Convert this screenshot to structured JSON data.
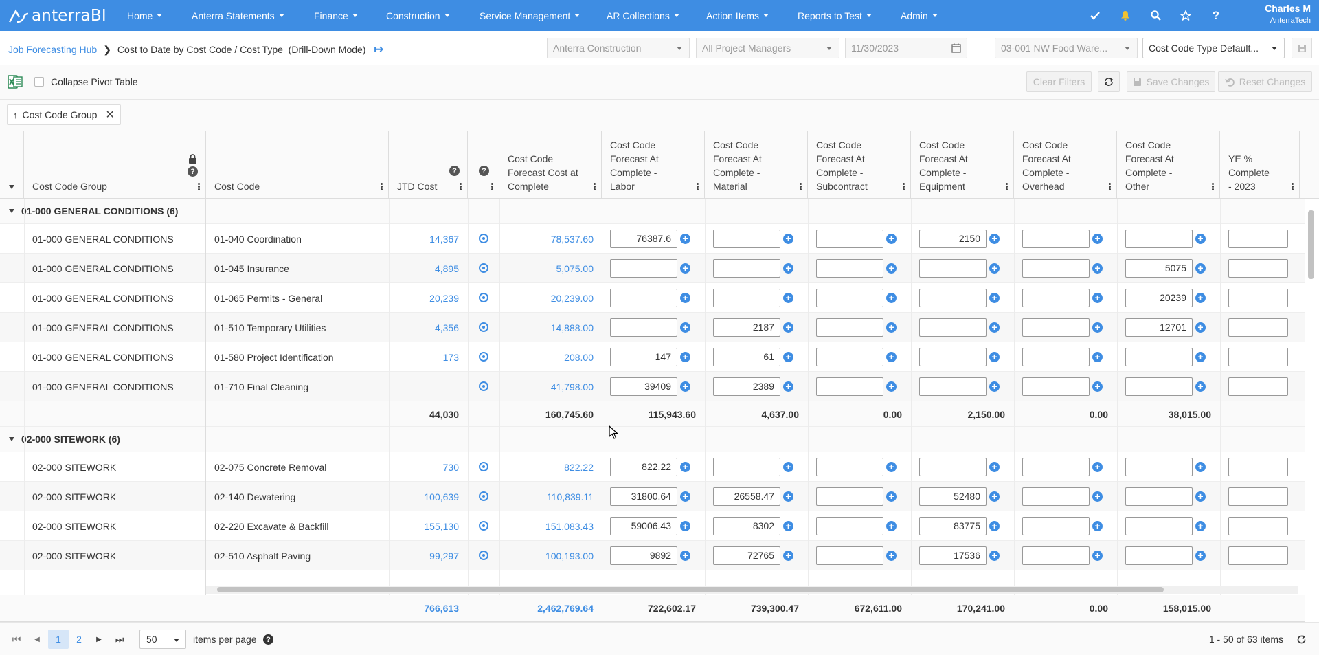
{
  "brand": {
    "name": "anterraBI"
  },
  "nav": {
    "menus": [
      "Home",
      "Anterra Statements",
      "Finance",
      "Construction",
      "Service Management",
      "AR Collections",
      "Action Items",
      "Reports to Test",
      "Admin"
    ],
    "icons": [
      "check-icon",
      "bell-icon",
      "search-icon",
      "star-icon",
      "help-icon"
    ],
    "user_name": "Charles M",
    "user_org": "AnterraTech"
  },
  "breadcrumb": {
    "root": "Job Forecasting Hub",
    "current": "Cost to Date by Cost Code / Cost Type  (Drill-Down Mode)"
  },
  "filters": {
    "company": "Anterra Construction",
    "managers": "All Project Managers",
    "date": "11/30/2023",
    "project": "03-001 NW Food Ware...",
    "cost_type": "Cost Code Type Default..."
  },
  "toolbar": {
    "collapse_label": "Collapse Pivot Table",
    "clear_filters": "Clear Filters",
    "save_changes": "Save Changes",
    "reset_changes": "Reset Changes"
  },
  "group_chip": {
    "label": "Cost Code Group"
  },
  "columns": {
    "group": "Cost Code Group",
    "code": "Cost Code",
    "jtd": "JTD Cost",
    "forecast_total": "Cost Code Forecast Cost at Complete",
    "labor": "Cost Code Forecast At Complete - Labor",
    "material": "Cost Code Forecast At Complete - Material",
    "subcontract": "Cost Code Forecast At Complete - Subcontract",
    "equipment": "Cost Code Forecast At Complete - Equipment",
    "overhead": "Cost Code Forecast At Complete - Overhead",
    "other": "Cost Code Forecast At Complete - Other",
    "ye": "YE % Complete - 2023"
  },
  "groups": [
    {
      "title": "01-000 GENERAL CONDITIONS (6)",
      "rows": [
        {
          "group": "01-000 GENERAL CONDITIONS",
          "code": "01-040 Coordination",
          "jtd": "14,367",
          "total": "78,537.60",
          "labor": "76387.6",
          "material": "",
          "subcontract": "",
          "equipment": "2150",
          "overhead": "",
          "other": "",
          "ye": ""
        },
        {
          "group": "01-000 GENERAL CONDITIONS",
          "code": "01-045 Insurance",
          "jtd": "4,895",
          "total": "5,075.00",
          "labor": "",
          "material": "",
          "subcontract": "",
          "equipment": "",
          "overhead": "",
          "other": "5075",
          "ye": ""
        },
        {
          "group": "01-000 GENERAL CONDITIONS",
          "code": "01-065 Permits - General",
          "jtd": "20,239",
          "total": "20,239.00",
          "labor": "",
          "material": "",
          "subcontract": "",
          "equipment": "",
          "overhead": "",
          "other": "20239",
          "ye": ""
        },
        {
          "group": "01-000 GENERAL CONDITIONS",
          "code": "01-510 Temporary Utilities",
          "jtd": "4,356",
          "total": "14,888.00",
          "labor": "",
          "material": "2187",
          "subcontract": "",
          "equipment": "",
          "overhead": "",
          "other": "12701",
          "ye": ""
        },
        {
          "group": "01-000 GENERAL CONDITIONS",
          "code": "01-580 Project Identification",
          "jtd": "173",
          "total": "208.00",
          "labor": "147",
          "material": "61",
          "subcontract": "",
          "equipment": "",
          "overhead": "",
          "other": "",
          "ye": ""
        },
        {
          "group": "01-000 GENERAL CONDITIONS",
          "code": "01-710 Final Cleaning",
          "jtd": "",
          "total": "41,798.00",
          "labor": "39409",
          "material": "2389",
          "subcontract": "",
          "equipment": "",
          "overhead": "",
          "other": "",
          "ye": ""
        }
      ],
      "subtotal": {
        "jtd": "44,030",
        "total": "160,745.60",
        "labor": "115,943.60",
        "material": "4,637.00",
        "subcontract": "0.00",
        "equipment": "2,150.00",
        "overhead": "0.00",
        "other": "38,015.00"
      }
    },
    {
      "title": "02-000 SITEWORK (6)",
      "rows": [
        {
          "group": "02-000 SITEWORK",
          "code": "02-075 Concrete Removal",
          "jtd": "730",
          "total": "822.22",
          "labor": "822.22",
          "material": "",
          "subcontract": "",
          "equipment": "",
          "overhead": "",
          "other": "",
          "ye": ""
        },
        {
          "group": "02-000 SITEWORK",
          "code": "02-140 Dewatering",
          "jtd": "100,639",
          "total": "110,839.11",
          "labor": "31800.64",
          "material": "26558.47",
          "subcontract": "",
          "equipment": "52480",
          "overhead": "",
          "other": "",
          "ye": ""
        },
        {
          "group": "02-000 SITEWORK",
          "code": "02-220 Excavate & Backfill",
          "jtd": "155,130",
          "total": "151,083.43",
          "labor": "59006.43",
          "material": "8302",
          "subcontract": "",
          "equipment": "83775",
          "overhead": "",
          "other": "",
          "ye": ""
        },
        {
          "group": "02-000 SITEWORK",
          "code": "02-510 Asphalt Paving",
          "jtd": "99,297",
          "total": "100,193.00",
          "labor": "9892",
          "material": "72765",
          "subcontract": "",
          "equipment": "17536",
          "overhead": "",
          "other": "",
          "ye": ""
        }
      ]
    }
  ],
  "grand_total": {
    "jtd": "766,613",
    "total": "2,462,769.64",
    "labor": "722,602.17",
    "material": "739,300.47",
    "subcontract": "672,611.00",
    "equipment": "170,241.00",
    "overhead": "0.00",
    "other": "158,015.00"
  },
  "pager": {
    "pages": [
      "1",
      "2"
    ],
    "page_size": "50",
    "per_page_label": "items per page",
    "summary": "1 - 50 of 63 items"
  }
}
